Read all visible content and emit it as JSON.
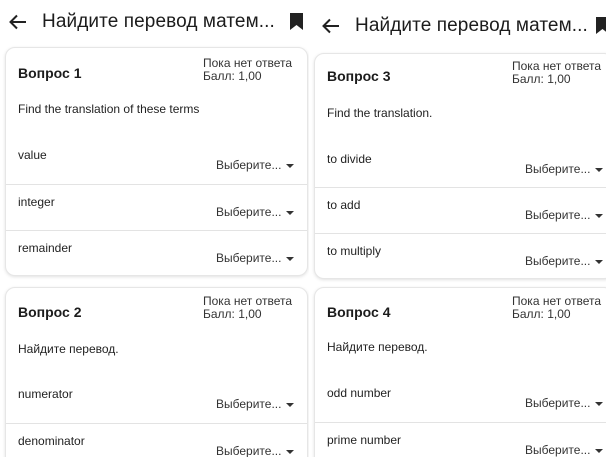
{
  "left": {
    "header": {
      "title": "Найдите перевод матем..."
    },
    "questions": [
      {
        "title": "Вопрос 1",
        "status": "Пока нет ответа",
        "score": "Балл: 1,00",
        "prompt": "Find the translation of these terms",
        "rows": [
          {
            "term": "value",
            "select": "Выберите..."
          },
          {
            "term": "integer",
            "select": "Выберите..."
          },
          {
            "term": "remainder",
            "select": "Выберите..."
          }
        ]
      },
      {
        "title": "Вопрос 2",
        "status": "Пока нет ответа",
        "score": "Балл: 1,00",
        "prompt": "Найдите перевод.",
        "rows": [
          {
            "term": "numerator",
            "select": "Выберите..."
          },
          {
            "term": "denominator",
            "select": "Выберите..."
          }
        ]
      }
    ]
  },
  "right": {
    "header": {
      "title": "Найдите перевод матем..."
    },
    "questions": [
      {
        "title": "Вопрос 3",
        "status": "Пока нет ответа",
        "score": "Балл: 1,00",
        "prompt": "Find the translation.",
        "rows": [
          {
            "term": "to divide",
            "select": "Выберите..."
          },
          {
            "term": "to add",
            "select": "Выберите..."
          },
          {
            "term": "to multiply",
            "select": "Выберите..."
          }
        ]
      },
      {
        "title": "Вопрос 4",
        "status": "Пока нет ответа",
        "score": "Балл: 1,00",
        "prompt": "Найдите перевод.",
        "rows": [
          {
            "term": "odd number",
            "select": "Выберите..."
          },
          {
            "term": "prime number",
            "select": "Выберите..."
          }
        ]
      }
    ]
  },
  "icons": {
    "back": "arrow-left-icon",
    "bookmark": "bookmark-icon",
    "dropdown": "caret-down-icon"
  },
  "colors": {
    "text": "#1c1c1c",
    "divider": "#e3e3e3",
    "card_border": "#e6e6e6"
  }
}
